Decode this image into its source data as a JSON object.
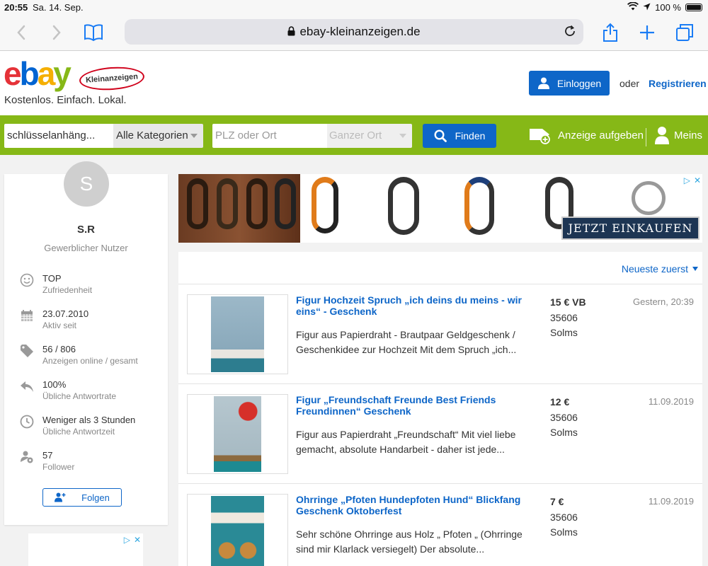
{
  "statusbar": {
    "time": "20:55",
    "date": "Sa. 14. Sep.",
    "battery": "100 %"
  },
  "browser": {
    "url": "ebay-kleinanzeigen.de"
  },
  "header": {
    "badge": "Kleinanzeigen",
    "tagline": "Kostenlos. Einfach. Lokal.",
    "login_label": "Einloggen",
    "or_label": "oder",
    "register_label": "Registrieren"
  },
  "search": {
    "query": "schlüsselanhäng...",
    "category": "Alle Kategorien",
    "location_placeholder": "PLZ oder Ort",
    "radius": "Ganzer Ort",
    "find_label": "Finden",
    "post_ad_label": "Anzeige aufgeben",
    "meins_label": "Meins"
  },
  "profile": {
    "initial": "S",
    "name": "S.R",
    "type": "Gewerblicher Nutzer",
    "stats": [
      {
        "icon": "smiley-icon",
        "value": "TOP",
        "label": "Zufriedenheit"
      },
      {
        "icon": "calendar-icon",
        "value": "23.07.2010",
        "label": "Aktiv seit"
      },
      {
        "icon": "tag-icon",
        "value": "56 / 806",
        "label": "Anzeigen online / gesamt"
      },
      {
        "icon": "reply-icon",
        "value": "100%",
        "label": "Übliche Antwortrate"
      },
      {
        "icon": "clock-icon",
        "value": "Weniger als 3 Stunden",
        "label": "Übliche Antwortzeit"
      },
      {
        "icon": "followers-icon",
        "value": "57",
        "label": "Follower"
      }
    ],
    "follow_label": "Folgen"
  },
  "banner": {
    "cta": "JETZT EINKAUFEN"
  },
  "listings": {
    "sort_label": "Neueste zuerst",
    "items": [
      {
        "title": "Figur Hochzeit Spruch „ich deins du meins - wir eins“ - Geschenk",
        "desc": "Figur aus Papierdraht - Brautpaar Geldgeschenk / Geschenkidee zur Hochzeit Mit dem Spruch „ich...",
        "price": "15 € VB",
        "zip": "35606",
        "city": "Solms",
        "date": "Gestern, 20:39"
      },
      {
        "title": "Figur „Freundschaft Freunde Best Friends Freundinnen“ Geschenk",
        "desc": "Figur aus Papierdraht „Freundschaft“ Mit viel liebe gemacht, absolute Handarbeit - daher ist jede...",
        "price": "12 €",
        "zip": "35606",
        "city": "Solms",
        "date": "11.09.2019"
      },
      {
        "title": "Ohrringe „Pfoten Hundepfoten Hund“ Blickfang Geschenk Oktoberfest",
        "desc": "Sehr schöne Ohrringe aus Holz „ Pfoten „ (Ohrringe sind mir Klarlack versiegelt) Der absolute...",
        "price": "7 €",
        "zip": "35606",
        "city": "Solms",
        "date": "11.09.2019"
      }
    ]
  },
  "colors": {
    "ebay_green": "#86b817",
    "ebay_blue": "#0e66c8",
    "safari_blue": "#1a7cf5"
  }
}
